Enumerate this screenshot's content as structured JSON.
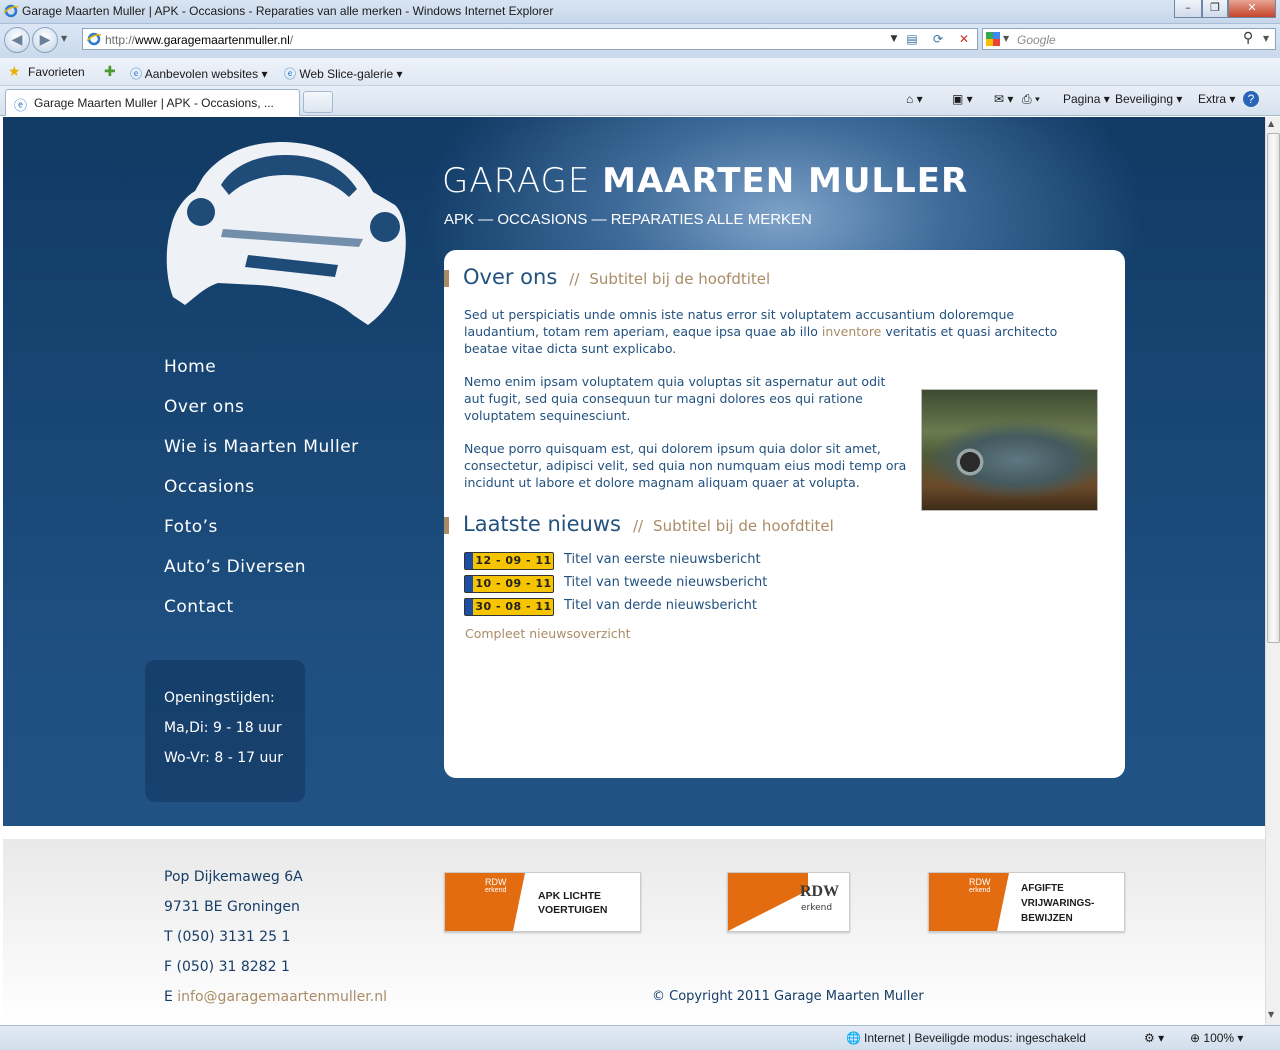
{
  "window": {
    "title": "Garage Maarten Muller | APK - Occasions - Reparaties van alle merken  -  Windows Internet Explorer"
  },
  "address": {
    "url_prefix": "http://",
    "url_domain": "www.garagemaartenmuller.nl",
    "url_suffix": "/"
  },
  "search": {
    "placeholder": "Google"
  },
  "favorites": {
    "label": "Favorieten",
    "items": [
      "Aanbevolen websites",
      "Web Slice-galerie"
    ]
  },
  "tab": {
    "title": "Garage Maarten Muller | APK - Occasions, ..."
  },
  "commandbar": {
    "pagina": "Pagina",
    "beveiliging": "Beveiliging",
    "extra": "Extra"
  },
  "site": {
    "brand_light": "GARAGE",
    "brand_bold": "MAARTEN MULLER",
    "tagline": "APK — OCCASIONS — REPARATIES ALLE MERKEN",
    "menu": [
      "Home",
      "Over ons",
      "Wie is Maarten Muller",
      "Occasions",
      "Foto’s",
      "Auto’s Diversen",
      "Contact"
    ],
    "hours": {
      "title": "Openingstijden:",
      "line1": "Ma,Di: 9 - 18 uur",
      "line2": "Wo-Vr: 8 - 17 uur"
    },
    "about": {
      "heading": "Over ons",
      "sep": "//",
      "subtitle": "Subtitel bij de hoofdtitel",
      "p1a": "Sed ut perspiciatis unde omnis iste natus error sit voluptatem accusantium doloremque laudantium, totam rem aperiam, eaque ipsa quae ab illo ",
      "p1link": "inventore",
      "p1b": " veritatis et quasi architecto beatae vitae dicta sunt explicabo.",
      "p2": "Nemo enim ipsam voluptatem quia voluptas sit aspernatur aut odit aut fugit, sed quia consequun tur magni dolores eos qui ratione voluptatem sequinesciunt.",
      "p3": "Neque porro quisquam est, qui dolorem ipsum quia dolor sit amet, consectetur, adipisci velit, sed quia non numquam eius modi temp ora incidunt ut labore et dolore magnam aliquam quaer at volupta."
    },
    "news": {
      "heading": "Laatste nieuws",
      "sep": "//",
      "subtitle": "Subtitel bij de hoofdtitel",
      "items": [
        {
          "date": "12 - 09 - 11",
          "title": "Titel van eerste nieuwsbericht"
        },
        {
          "date": "10 - 09 - 11",
          "title": "Titel van tweede nieuwsbericht"
        },
        {
          "date": "30 - 08 - 11",
          "title": "Titel van derde nieuwsbericht"
        }
      ],
      "more": "Compleet nieuwsoverzicht"
    },
    "footer": {
      "street": "Pop Dijkemaweg 6A",
      "city": "9731 BE Groningen",
      "phone": "T (050) 3131 25 1",
      "fax": "F (050) 31 8282 1",
      "email_prefix": "E ",
      "email": "info@garagemaartenmuller.nl",
      "copyright": "© Copyright 2011 Garage Maarten Muller",
      "badges": [
        {
          "brand": "RDW",
          "sub": "erkend",
          "text": "APK LICHTE\nVOERTUIGEN"
        },
        {
          "brand": "RDW",
          "sub": "erkend",
          "text": ""
        },
        {
          "brand": "RDW",
          "sub": "erkend",
          "text": "AFGIFTE\nVRIJWARINGS-\nBEWIJZEN"
        }
      ]
    }
  },
  "status": {
    "zone": "Internet | Beveiligde modus: ingeschakeld",
    "zoom": "100%"
  }
}
